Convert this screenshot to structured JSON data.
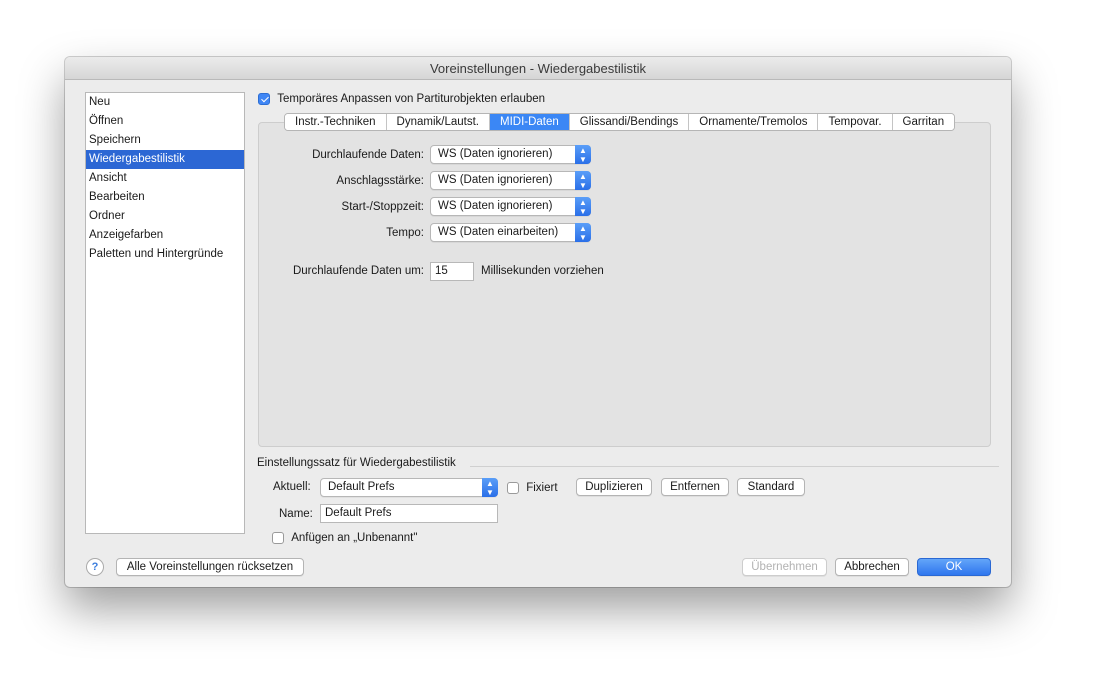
{
  "window": {
    "title": "Voreinstellungen - Wiedergabestilistik"
  },
  "sidebar": {
    "items": [
      {
        "label": "Neu"
      },
      {
        "label": "Öffnen"
      },
      {
        "label": "Speichern"
      },
      {
        "label": "Wiedergabestilistik"
      },
      {
        "label": "Ansicht"
      },
      {
        "label": "Bearbeiten"
      },
      {
        "label": "Ordner"
      },
      {
        "label": "Anzeigefarben"
      },
      {
        "label": "Paletten und Hintergründe"
      }
    ],
    "selected": "Wiedergabestilistik"
  },
  "temp_adjust": {
    "label": "Temporäres Anpassen von Partiturobjekten erlauben",
    "checked": true
  },
  "tabs": [
    {
      "label": "Instr.-Techniken"
    },
    {
      "label": "Dynamik/Lautst."
    },
    {
      "label": "MIDI-Daten"
    },
    {
      "label": "Glissandi/Bendings"
    },
    {
      "label": "Ornamente/Tremolos"
    },
    {
      "label": "Tempovar."
    },
    {
      "label": "Garritan"
    }
  ],
  "active_tab": "MIDI-Daten",
  "midi": {
    "rows": [
      {
        "label": "Durchlaufende Daten:",
        "value": "WS (Daten ignorieren)"
      },
      {
        "label": "Anschlagsstärke:",
        "value": "WS (Daten ignorieren)"
      },
      {
        "label": "Start-/Stoppzeit:",
        "value": "WS (Daten ignorieren)"
      },
      {
        "label": "Tempo:",
        "value": "WS (Daten einarbeiten)"
      }
    ],
    "advance_label": "Durchlaufende Daten um:",
    "advance_value": "15",
    "advance_unit": "Millisekunden vorziehen"
  },
  "preset": {
    "section_title": "Einstellungssatz für Wiedergabestilistik",
    "current_label": "Aktuell:",
    "current_value": "Default Prefs",
    "fixed_label": "Fixiert",
    "fixed_checked": false,
    "duplicate_label": "Duplizieren",
    "remove_label": "Entfernen",
    "standard_label": "Standard",
    "name_label": "Name:",
    "name_value": "Default Prefs",
    "append_label": "Anfügen an „Unbenannt\""
  },
  "footer": {
    "help": "?",
    "reset_label": "Alle Voreinstellungen rücksetzen",
    "apply_label": "Übernehmen",
    "cancel_label": "Abbrechen",
    "ok_label": "OK"
  },
  "colors": {
    "accent": "#3b87f5",
    "selection": "#2c67d4"
  }
}
